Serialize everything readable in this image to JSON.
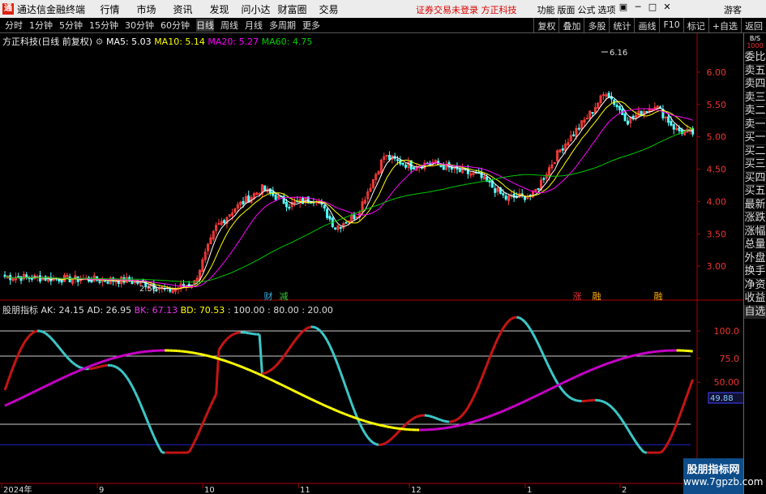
{
  "app": {
    "title": "通达信金融终端",
    "logo": "通"
  },
  "menu": [
    "行情",
    "市场",
    "资讯",
    "发现",
    "问小达",
    "财富圈",
    "交易"
  ],
  "broker_login": "证券交易未登录  方正科技",
  "right_menu": [
    "功能",
    "版面",
    "公式",
    "选项"
  ],
  "guest": "游客",
  "periods": [
    "分时",
    "1分钟",
    "5分钟",
    "15分钟",
    "30分钟",
    "60分钟",
    "日线",
    "周线",
    "月线",
    "多周期",
    "更多"
  ],
  "selected_period": "日线",
  "toolbar_right": [
    "复权",
    "叠加",
    "多股",
    "统计",
    "画线",
    "F10",
    "标记",
    "+自选",
    "返回"
  ],
  "chart_title": {
    "stock": "方正科技(日线 前复权)",
    "ma5": "MA5: 5.03",
    "ma10": "MA10: 5.14",
    "ma20": "MA20: 5.27",
    "ma60": "MA60: 4.75"
  },
  "indicator_title": {
    "name": "股朋指标",
    "ak": "AK: 24.15",
    "ad": "AD: 26.95",
    "bk": "BK: 67.13",
    "bd": "BD: 70.53",
    "l100": ": 100.00",
    "l80": ": 80.00",
    "l20": ": 20.00"
  },
  "price_axis": [
    "6.00",
    "5.50",
    "5.00",
    "4.50",
    "4.00",
    "3.50",
    "3.00"
  ],
  "ind_axis": [
    "100.0",
    "75.0",
    "50.00"
  ],
  "ind_value_tag": "49.88",
  "annotations": {
    "high": "6.16",
    "low": "2.58"
  },
  "events": [
    {
      "label": "财",
      "color": "#3ad"
    },
    {
      "label": "减",
      "color": "#3c3"
    },
    {
      "label": "涨",
      "color": "#e33"
    },
    {
      "label": "融",
      "color": "#fa0"
    },
    {
      "label": "融",
      "color": "#fa0"
    }
  ],
  "date_axis": [
    "2024年",
    "9",
    "10",
    "11",
    "12",
    "1",
    "2"
  ],
  "right_panel": {
    "hdr1": "B/S",
    "hdr2": "1000",
    "items": [
      "委比",
      "卖五",
      "卖四",
      "卖三",
      "卖二",
      "卖一",
      "买一",
      "买二",
      "买三",
      "买四",
      "买五",
      "最新",
      "涨跌",
      "涨幅",
      "总量",
      "外盘",
      "换手",
      "净资",
      "收益",
      "自选"
    ]
  },
  "watermark": {
    "line1": "股朋指标网",
    "line2": "www.7gpzb.com"
  },
  "colors": {
    "up": "#ff3c3c",
    "down": "#54ffff",
    "ma5": "#ffffff",
    "ma10": "#ffff00",
    "ma20": "#ff00ff",
    "ma60": "#00c800",
    "ak": "#c81414",
    "ad": "#3cc8c8",
    "bk": "#c800c8",
    "bd": "#ffff00"
  }
}
